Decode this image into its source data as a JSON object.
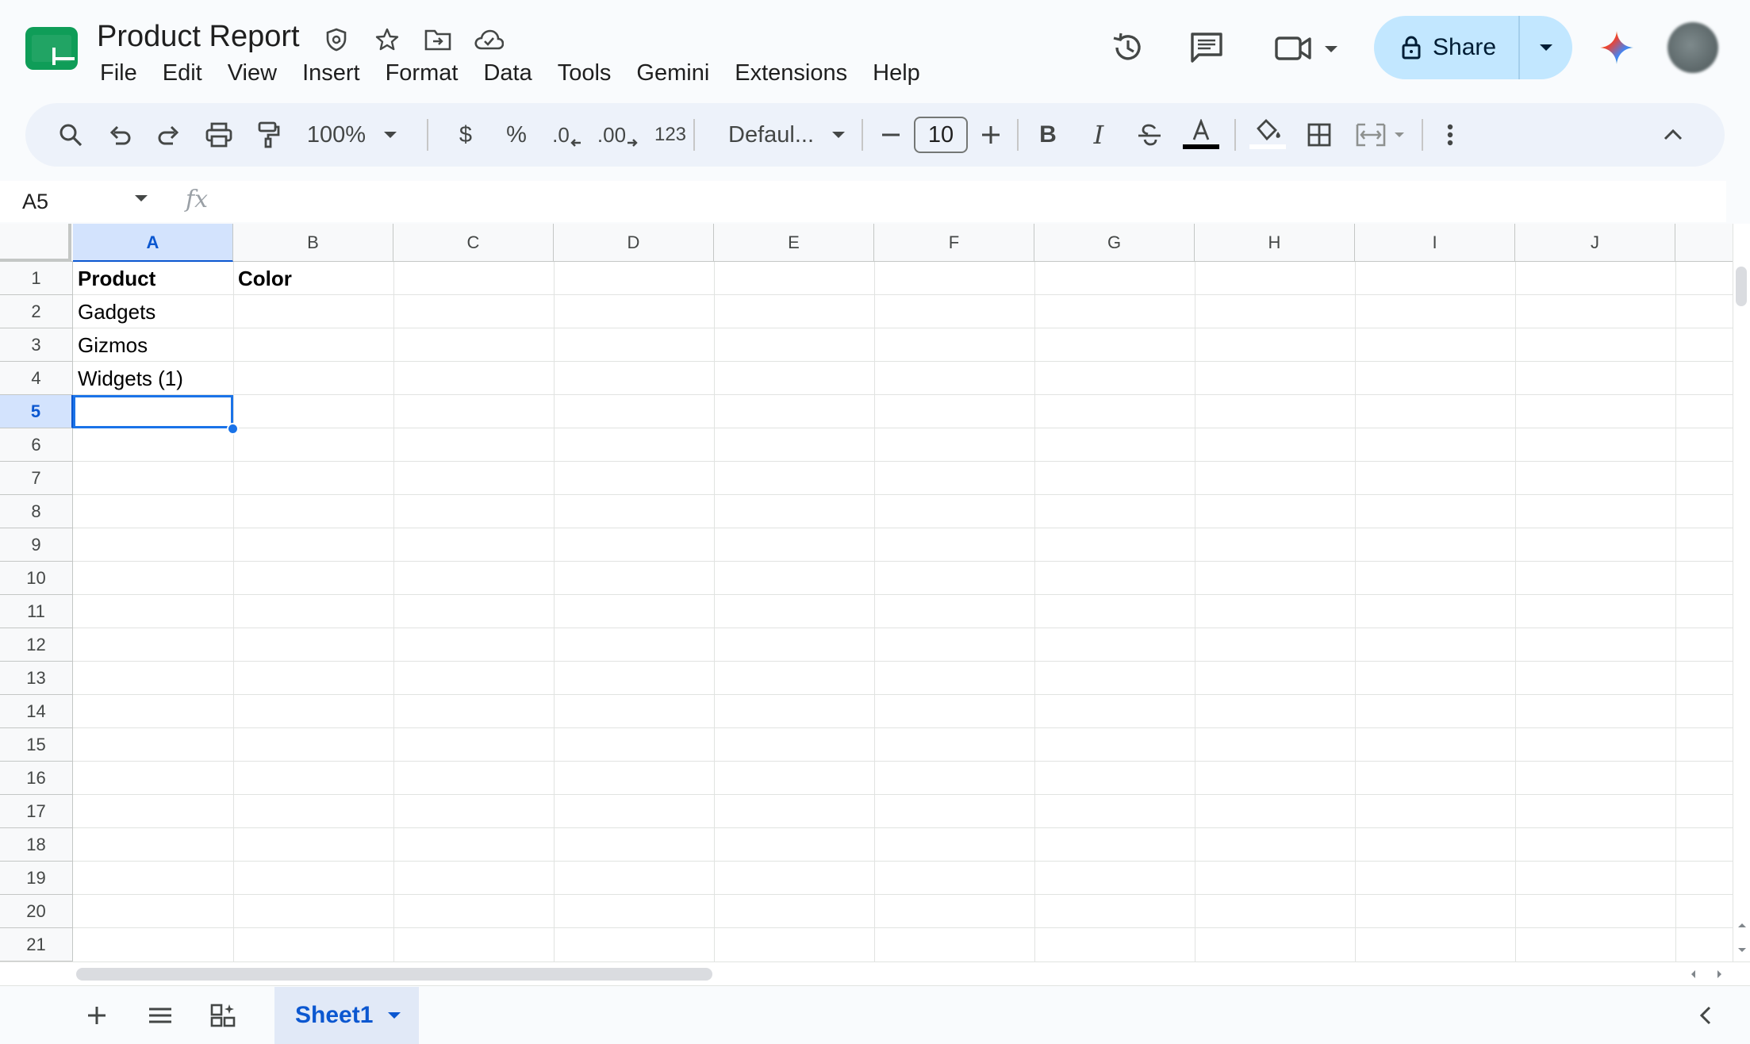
{
  "app": {
    "doc_title": "Product Report",
    "menu": [
      "File",
      "Edit",
      "View",
      "Insert",
      "Format",
      "Data",
      "Tools",
      "Gemini",
      "Extensions",
      "Help"
    ],
    "share_label": "Share"
  },
  "toolbar": {
    "zoom": "100%",
    "currency": "$",
    "percent": "%",
    "decrease_decimal": ".0",
    "increase_decimal": ".00",
    "number_format": "123",
    "font_name": "Defaul...",
    "font_size": "10"
  },
  "formula_bar": {
    "cell_ref": "A5",
    "fx": "fx"
  },
  "grid": {
    "columns": [
      "A",
      "B",
      "C",
      "D",
      "E",
      "F",
      "G",
      "H",
      "I",
      "J"
    ],
    "rows": [
      "1",
      "2",
      "3",
      "4",
      "5",
      "6",
      "7",
      "8",
      "9",
      "10",
      "11",
      "12",
      "13",
      "14",
      "15",
      "16",
      "17",
      "18",
      "19",
      "20",
      "21"
    ],
    "selected_column": "A",
    "selected_row": "5",
    "cells": {
      "A1": "Product",
      "B1": "Color",
      "A2": "Gadgets",
      "A3": "Gizmos",
      "A4": "Widgets (1)"
    }
  },
  "sheets": {
    "active_tab": "Sheet1"
  },
  "colors": {
    "accent": "#0b57d0",
    "share_bg": "#c2e7ff",
    "selection": "#1a73e8",
    "logo_green": "#0f9d58"
  },
  "icons": [
    "sheets-logo-icon",
    "shield-icon",
    "star-icon",
    "move-folder-icon",
    "cloud-check-icon",
    "history-icon",
    "comment-icon",
    "video-icon",
    "lock-icon",
    "gemini-icon",
    "search-icon",
    "undo-icon",
    "redo-icon",
    "print-icon",
    "paint-format-icon",
    "bold-icon",
    "italic-icon",
    "strikethrough-icon",
    "text-color-icon",
    "fill-color-icon",
    "borders-icon",
    "merge-icon",
    "more-icon",
    "collapse-icon",
    "add-sheet-icon",
    "all-sheets-icon",
    "explore-icon"
  ]
}
